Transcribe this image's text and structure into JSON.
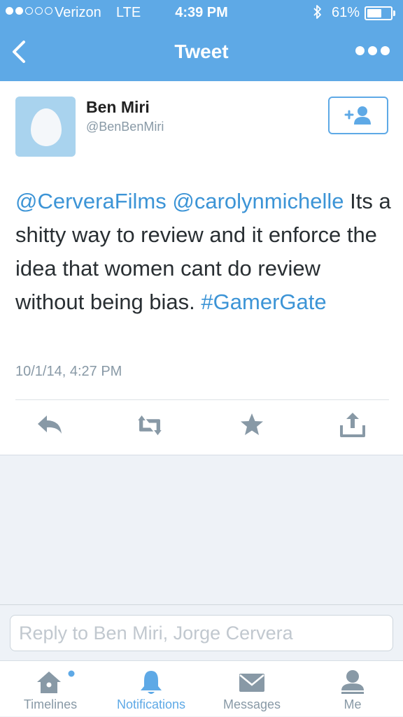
{
  "status_bar": {
    "carrier": "Verizon",
    "network": "LTE",
    "time": "4:39 PM",
    "battery_percent": "61%",
    "battery_level": 0.61,
    "signal_bars_filled": 2,
    "signal_bars_total": 5
  },
  "nav": {
    "title": "Tweet"
  },
  "tweet": {
    "author_name": "Ben Miri",
    "author_handle": "@BenBenMiri",
    "mention_1": "@CerveraFilms",
    "mention_2": "@carolynmichelle",
    "text": "Its a shitty way to review and it enforce the idea that women cant do review without being bias.",
    "hashtag": "#GamerGate",
    "timestamp": "10/1/14, 4:27 PM"
  },
  "reply": {
    "placeholder": "Reply to Ben Miri, Jorge Cervera"
  },
  "tabs": [
    {
      "label": "Timelines",
      "icon": "home-icon",
      "active": false
    },
    {
      "label": "Notifications",
      "icon": "bell-icon",
      "active": true
    },
    {
      "label": "Messages",
      "icon": "envelope-icon",
      "active": false
    },
    {
      "label": "Me",
      "icon": "person-icon",
      "active": false
    }
  ],
  "colors": {
    "accent": "#5ea9e6",
    "link": "#3c94d6",
    "muted": "#8899a6"
  }
}
